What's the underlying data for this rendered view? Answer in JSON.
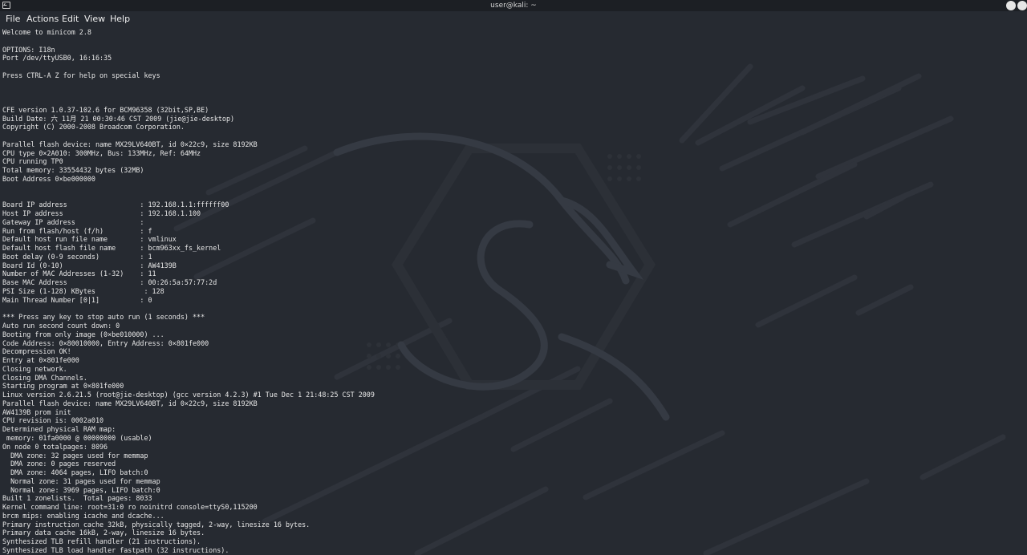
{
  "window": {
    "title": "user@kali: ~",
    "icon": "terminal-icon"
  },
  "menu": {
    "file": "File",
    "actions": "Actions",
    "edit": "Edit",
    "view": "View",
    "help": "Help"
  },
  "terminal": {
    "lines": [
      "Welcome to minicom 2.8",
      "",
      "OPTIONS: I18n",
      "Port /dev/ttyUSB0, 16:16:35",
      "",
      "Press CTRL-A Z for help on special keys",
      "",
      "",
      "",
      "CFE version 1.0.37-102.6 for BCM96358 (32bit,SP,BE)",
      "Build Date: 六 11月 21 00:30:46 CST 2009 (jie@jie-desktop)",
      "Copyright (C) 2000-2008 Broadcom Corporation.",
      "",
      "Parallel flash device: name MX29LV640BT, id 0×22c9, size 8192KB",
      "CPU type 0×2A010: 300MHz, Bus: 133MHz, Ref: 64MHz",
      "CPU running TP0",
      "Total memory: 33554432 bytes (32MB)",
      "Boot Address 0×be000000",
      "",
      "",
      "Board IP address                  : 192.168.1.1:ffffff00",
      "Host IP address                   : 192.168.1.100",
      "Gateway IP address                :",
      "Run from flash/host (f/h)         : f",
      "Default host run file name        : vmlinux",
      "Default host flash file name      : bcm963xx_fs_kernel",
      "Boot delay (0-9 seconds)          : 1",
      "Board Id (0-10)                   : AW4139B",
      "Number of MAC Addresses (1-32)    : 11",
      "Base MAC Address                  : 00:26:5a:57:77:2d",
      "PSI Size (1-128) KBytes            : 128",
      "Main Thread Number [0|1]          : 0",
      "",
      "*** Press any key to stop auto run (1 seconds) ***",
      "Auto run second count down: 0",
      "Booting from only image (0×be010000) ...",
      "Code Address: 0×80010000, Entry Address: 0×801fe000",
      "Decompression OK!",
      "Entry at 0×801fe000",
      "Closing network.",
      "Closing DMA Channels.",
      "Starting program at 0×801fe000",
      "Linux version 2.6.21.5 (root@jie-desktop) (gcc version 4.2.3) #1 Tue Dec 1 21:48:25 CST 2009",
      "Parallel flash device: name MX29LV640BT, id 0×22c9, size 8192KB",
      "AW4139B prom init",
      "CPU revision is: 0002a010",
      "Determined physical RAM map:",
      " memory: 01fa0000 @ 00000000 (usable)",
      "On node 0 totalpages: 8096",
      "  DMA zone: 32 pages used for memmap",
      "  DMA zone: 0 pages reserved",
      "  DMA zone: 4064 pages, LIFO batch:0",
      "  Normal zone: 31 pages used for memmap",
      "  Normal zone: 3969 pages, LIFO batch:0",
      "Built 1 zonelists.  Total pages: 8033",
      "Kernel command line: root=31:0 ro noinitrd console=ttyS0,115200",
      "brcm mips: enabling icache and dcache...",
      "Primary instruction cache 32kB, physically tagged, 2-way, linesize 16 bytes.",
      "Primary data cache 16kB, 2-way, linesize 16 bytes.",
      "Synthesized TLB refill handler (21 instructions).",
      "Synthesized TLB load handler fastpath (32 instructions)."
    ]
  }
}
